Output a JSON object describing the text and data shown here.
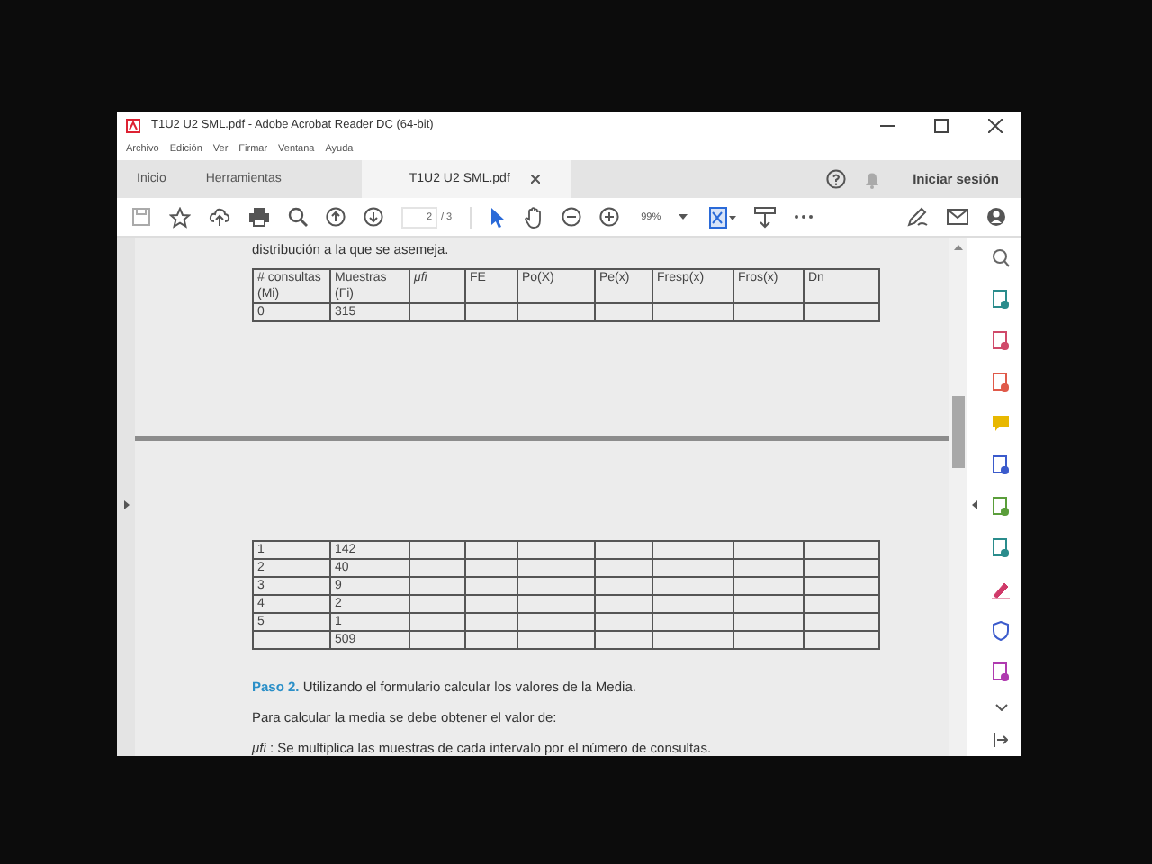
{
  "window": {
    "title": "T1U2 U2 SML.pdf - Adobe Acrobat Reader DC (64-bit)"
  },
  "menu": [
    "Archivo",
    "Edición",
    "Ver",
    "Firmar",
    "Ventana",
    "Ayuda"
  ],
  "tabs": [
    {
      "label": "Inicio",
      "selected": false
    },
    {
      "label": "Herramientas",
      "selected": false
    },
    {
      "label": "T1U2 U2 SML.pdf",
      "selected": true,
      "closable": true
    }
  ],
  "sign_in": "Iniciar sesión",
  "toolbar": {
    "page": "2",
    "page_total": "/ 3",
    "zoom": "99%"
  },
  "document": {
    "intro": "distribución a la que se asemeja.",
    "columns": [
      {
        "label": "# consultas (Mi)"
      },
      {
        "label": "Muestras (Fi)"
      },
      {
        "label": "μfi",
        "italic": true
      },
      {
        "label": "FE"
      },
      {
        "label": "Po(X)"
      },
      {
        "label": "Pe(x)"
      },
      {
        "label": "Fresp(x)"
      },
      {
        "label": "Fros(x)"
      },
      {
        "label": "Dn"
      }
    ],
    "rows_page1": [
      {
        "mi": "0",
        "fi": "315"
      }
    ],
    "rows_page2": [
      {
        "mi": "1",
        "fi": "142"
      },
      {
        "mi": "2",
        "fi": "40"
      },
      {
        "mi": "3",
        "fi": "9"
      },
      {
        "mi": "4",
        "fi": "2"
      },
      {
        "mi": "5",
        "fi": "1"
      },
      {
        "fi": "509"
      }
    ],
    "step_label": "Paso 2.",
    "step_text": "Utilizando el formulario calcular los valores de la Media.",
    "paragraph": "Para calcular la media se debe obtener el valor de:",
    "definition": "*μfi* : Se multiplica las muestras de cada intervalo por el número de consultas."
  }
}
